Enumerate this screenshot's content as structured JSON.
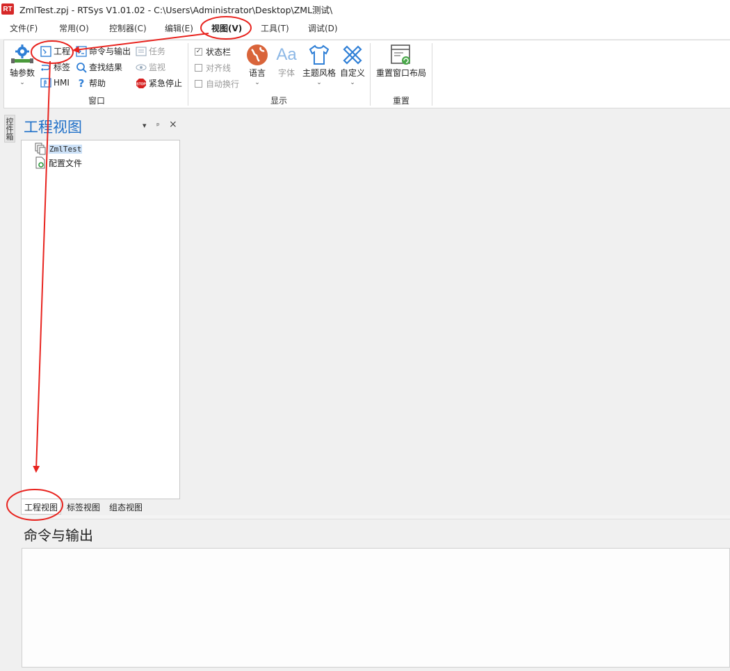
{
  "window": {
    "logo": "RT",
    "title": "ZmlTest.zpj - RTSys V1.01.02 - C:\\Users\\Administrator\\Desktop\\ZML测试\\"
  },
  "menu": {
    "items": [
      "文件(F)",
      "常用(O)",
      "控制器(C)",
      "编辑(E)",
      "视图(V)",
      "工具(T)",
      "调试(D)"
    ],
    "active": "视图(V)"
  },
  "ribbon": {
    "window_group": {
      "label": "窗口",
      "axis_params": "轴参数",
      "project": "工程",
      "label_btn": "标签",
      "hmi": "HMI",
      "cmd_output": "命令与输出",
      "find_results": "查找结果",
      "help": "帮助",
      "task": "任务",
      "monitor": "监视",
      "estop": "紧急停止",
      "estop_badge": "STOP"
    },
    "display_group": {
      "label": "显示",
      "status_bar": "状态栏",
      "align_line": "对齐线",
      "auto_wrap": "自动换行",
      "status_bar_checked": true,
      "language": "语言",
      "font": "字体",
      "font_glyph": "Aa",
      "theme": "主题风格",
      "custom": "自定义"
    },
    "reset_group": {
      "label": "重置",
      "reset_layout": "重置窗口布局"
    }
  },
  "toolbox_tab": "控件箱",
  "project_panel": {
    "title": "工程视图",
    "dropdown_glyph": "▾",
    "pin_glyph": "ᵖ",
    "close_glyph": "×",
    "tree": [
      {
        "label": "ZmlTest",
        "selected": true
      },
      {
        "label": "配置文件",
        "selected": false
      }
    ],
    "tabs": [
      "工程视图",
      "标签视图",
      "组态视图"
    ],
    "active_tab": "工程视图"
  },
  "output_panel": {
    "title": "命令与输出"
  },
  "colors": {
    "accent_blue": "#1e6fc8",
    "annotation_red": "#e8231e",
    "logo_red": "#d62828"
  }
}
